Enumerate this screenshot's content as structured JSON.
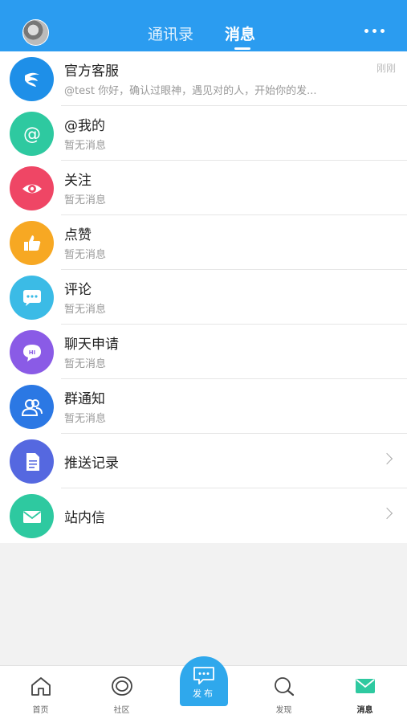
{
  "header": {
    "tabs": [
      {
        "label": "通讯录",
        "active": false
      },
      {
        "label": "消息",
        "active": true
      }
    ],
    "accent_color": "#2b9cf0"
  },
  "messages": [
    {
      "title": "官方客服",
      "subtitle": "@test 你好，确认过眼神，遇见对的人，开始你的发...",
      "time": "刚刚",
      "icon": "service-logo-icon",
      "color": "#1e8fe8"
    },
    {
      "title": "@我的",
      "subtitle": "暂无消息",
      "icon": "at-icon",
      "color": "#2ec9a0"
    },
    {
      "title": "关注",
      "subtitle": "暂无消息",
      "icon": "eye-icon",
      "color": "#ef4665"
    },
    {
      "title": "点赞",
      "subtitle": "暂无消息",
      "icon": "thumbs-up-icon",
      "color": "#f7a823"
    },
    {
      "title": "评论",
      "subtitle": "暂无消息",
      "icon": "comment-icon",
      "color": "#3bbbe6"
    },
    {
      "title": "聊天申请",
      "subtitle": "暂无消息",
      "icon": "chat-hi-icon",
      "color": "#8a5be6"
    },
    {
      "title": "群通知",
      "subtitle": "暂无消息",
      "icon": "group-icon",
      "color": "#2b78e4"
    },
    {
      "title": "推送记录",
      "icon": "document-icon",
      "color": "#5568e0"
    },
    {
      "title": "站内信",
      "icon": "mail-icon",
      "color": "#2ec9a0"
    }
  ],
  "bottom_nav": [
    {
      "label": "首页",
      "icon": "home-icon"
    },
    {
      "label": "社区",
      "icon": "community-icon"
    },
    {
      "label": "发布",
      "icon": "publish-icon"
    },
    {
      "label": "发现",
      "icon": "search-icon"
    },
    {
      "label": "消息",
      "icon": "message-icon",
      "active": true
    }
  ]
}
